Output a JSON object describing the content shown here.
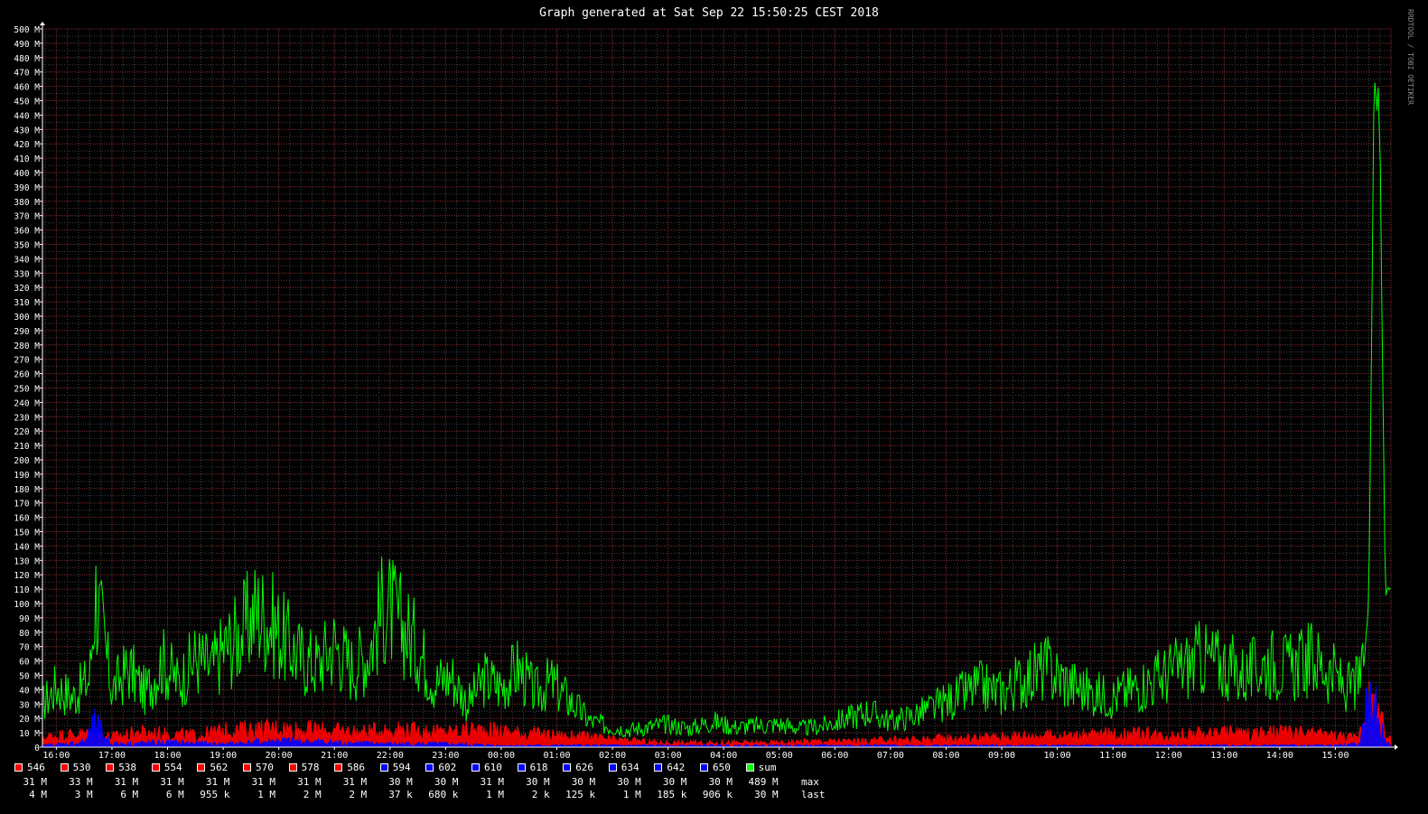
{
  "title": "Graph generated at Sat Sep 22 15:50:25 CEST 2018",
  "watermark": "RRDTOOL / TOBI OETIKER",
  "colors": {
    "background": "#000000",
    "grid": "#555555",
    "red": "#ff0000",
    "blue": "#0000ff",
    "green": "#00ff00",
    "text": "#ffffff"
  },
  "chart_data": {
    "type": "line",
    "title": "Graph generated at Sat Sep 22 15:50:25 CEST 2018",
    "ylim": [
      0,
      500
    ],
    "y_unit": "M",
    "yticks": [
      "0",
      "10 M",
      "20 M",
      "30 M",
      "40 M",
      "50 M",
      "60 M",
      "70 M",
      "80 M",
      "90 M",
      "100 M",
      "110 M",
      "120 M",
      "130 M",
      "140 M",
      "150 M",
      "160 M",
      "170 M",
      "180 M",
      "190 M",
      "200 M",
      "210 M",
      "220 M",
      "230 M",
      "240 M",
      "250 M",
      "260 M",
      "270 M",
      "280 M",
      "290 M",
      "300 M",
      "310 M",
      "320 M",
      "330 M",
      "340 M",
      "350 M",
      "360 M",
      "370 M",
      "380 M",
      "390 M",
      "400 M",
      "410 M",
      "420 M",
      "430 M",
      "440 M",
      "450 M",
      "460 M",
      "470 M",
      "480 M",
      "490 M",
      "500 M"
    ],
    "xticks": [
      "16:00",
      "17:00",
      "18:00",
      "19:00",
      "20:00",
      "21:00",
      "22:00",
      "23:00",
      "00:00",
      "01:00",
      "02:00",
      "03:00",
      "04:00",
      "05:00",
      "06:00",
      "07:00",
      "08:00",
      "09:00",
      "10:00",
      "11:00",
      "12:00",
      "13:00",
      "14:00",
      "15:00"
    ],
    "xrange_hours": [
      -0.25,
      24.0
    ],
    "grid": true,
    "series": [
      {
        "name": "sum",
        "color": "#00ff00",
        "x": [
          -0.25,
          0,
          0.3,
          0.6,
          0.7,
          1,
          1.3,
          1.6,
          1.9,
          2.2,
          2.5,
          2.8,
          3,
          3.3,
          3.6,
          3.9,
          4.1,
          4.4,
          4.7,
          5,
          5.3,
          5.6,
          5.9,
          6.2,
          6.5,
          6.8,
          7.1,
          7.4,
          7.7,
          8,
          8.3,
          8.6,
          8.9,
          9.3,
          9.6,
          10,
          10.3,
          10.6,
          11,
          11.4,
          11.8,
          12.2,
          12.6,
          13,
          13.4,
          13.8,
          14.2,
          14.6,
          15,
          15.4,
          15.8,
          16.2,
          16.6,
          17,
          17.4,
          17.8,
          18.2,
          18.6,
          19,
          19.4,
          19.8,
          20.2,
          20.6,
          21,
          21.4,
          21.8,
          22.2,
          22.6,
          23,
          23.2,
          23.4,
          23.5,
          23.6,
          23.7,
          23.8,
          23.9
        ],
        "values": [
          30,
          42,
          35,
          48,
          110,
          40,
          55,
          38,
          60,
          45,
          62,
          55,
          68,
          78,
          95,
          85,
          75,
          62,
          58,
          72,
          56,
          65,
          100,
          85,
          70,
          45,
          50,
          30,
          48,
          42,
          55,
          38,
          45,
          30,
          18,
          14,
          12,
          14,
          16,
          13,
          18,
          14,
          15,
          16,
          13,
          15,
          20,
          25,
          18,
          22,
          28,
          35,
          42,
          38,
          48,
          55,
          45,
          38,
          35,
          42,
          48,
          55,
          62,
          58,
          50,
          60,
          55,
          62,
          50,
          40,
          45,
          52,
          100,
          480,
          430,
          110
        ]
      },
      {
        "name": "red (546–586)",
        "color": "#ff0000",
        "x": [
          -0.25,
          0,
          0.5,
          1,
          1.5,
          2,
          2.5,
          3,
          3.5,
          4,
          4.5,
          5,
          5.5,
          6,
          6.5,
          7,
          7.5,
          8,
          8.5,
          9,
          9.5,
          10,
          10.5,
          11,
          11.5,
          12,
          12.5,
          13,
          13.5,
          14,
          14.5,
          15,
          15.5,
          16,
          16.5,
          17,
          17.5,
          18,
          18.5,
          19,
          19.5,
          20,
          20.5,
          21,
          21.5,
          22,
          22.5,
          23,
          23.4,
          23.6,
          23.8,
          23.9
        ],
        "values": [
          6,
          8,
          9,
          7,
          10,
          9,
          8,
          11,
          12,
          13,
          12,
          11,
          10,
          12,
          11,
          10,
          12,
          11,
          9,
          8,
          7,
          5,
          4,
          3,
          3,
          3,
          3,
          3,
          4,
          4,
          4,
          5,
          5,
          6,
          6,
          7,
          8,
          8,
          8,
          9,
          9,
          8,
          9,
          10,
          9,
          10,
          9,
          8,
          6,
          30,
          25,
          5
        ]
      },
      {
        "name": "blue (594–650)",
        "color": "#0000ff",
        "x": [
          -0.25,
          0.5,
          0.7,
          1,
          2,
          3,
          4,
          5,
          6,
          7,
          8,
          9,
          10,
          11,
          12,
          13,
          14,
          15,
          16,
          17,
          18,
          19,
          20,
          21,
          22,
          23,
          23.4,
          23.6,
          23.8,
          23.9
        ],
        "values": [
          1,
          3,
          15,
          2,
          3,
          2,
          4,
          3,
          2,
          2,
          1,
          1,
          1,
          1,
          1,
          1,
          1,
          1,
          1,
          1,
          1,
          1,
          1,
          1,
          1,
          1,
          2,
          30,
          20,
          2
        ]
      }
    ],
    "legend": [
      {
        "name": "546",
        "color": "#ff0000",
        "max": "31 M",
        "last": "4 M"
      },
      {
        "name": "530",
        "color": "#ff0000",
        "max": "33 M",
        "last": "3 M"
      },
      {
        "name": "538",
        "color": "#ff0000",
        "max": "31 M",
        "last": "6 M"
      },
      {
        "name": "554",
        "color": "#ff0000",
        "max": "31 M",
        "last": "6 M"
      },
      {
        "name": "562",
        "color": "#ff0000",
        "max": "31 M",
        "last": "955 k"
      },
      {
        "name": "570",
        "color": "#ff0000",
        "max": "31 M",
        "last": "1 M"
      },
      {
        "name": "578",
        "color": "#ff0000",
        "max": "31 M",
        "last": "2 M"
      },
      {
        "name": "586",
        "color": "#ff0000",
        "max": "31 M",
        "last": "2 M"
      },
      {
        "name": "594",
        "color": "#0000ff",
        "max": "30 M",
        "last": "37 k"
      },
      {
        "name": "602",
        "color": "#0000ff",
        "max": "30 M",
        "last": "680 k"
      },
      {
        "name": "610",
        "color": "#0000ff",
        "max": "31 M",
        "last": "1 M"
      },
      {
        "name": "618",
        "color": "#0000ff",
        "max": "30 M",
        "last": "2 k"
      },
      {
        "name": "626",
        "color": "#0000ff",
        "max": "30 M",
        "last": "125 k"
      },
      {
        "name": "634",
        "color": "#0000ff",
        "max": "30 M",
        "last": "1 M"
      },
      {
        "name": "642",
        "color": "#0000ff",
        "max": "30 M",
        "last": "185 k"
      },
      {
        "name": "650",
        "color": "#0000ff",
        "max": "30 M",
        "last": "906 k"
      },
      {
        "name": "sum",
        "color": "#00ff00",
        "max": "489 M",
        "last": "30 M"
      }
    ],
    "row_labels": {
      "max": "max",
      "last": "last"
    }
  }
}
